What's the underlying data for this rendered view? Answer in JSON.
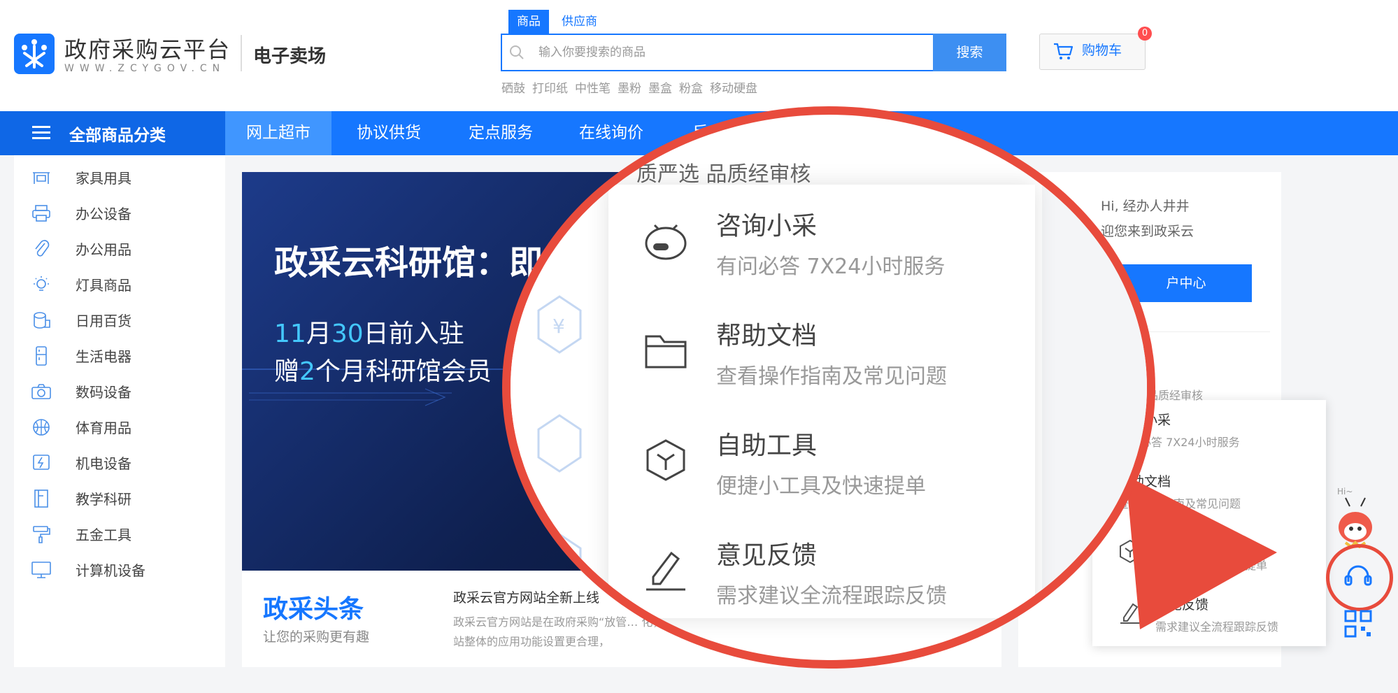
{
  "header": {
    "logo_name": "政府采购云平台",
    "logo_sub": "WWW.ZCYGOV.CN",
    "market_label": "电子卖场",
    "search_tabs": [
      "商品",
      "供应商"
    ],
    "search_placeholder": "输入你要搜索的商品",
    "search_button": "搜索",
    "hot_words": [
      "硒鼓",
      "打印纸",
      "中性笔",
      "墨粉",
      "墨盒",
      "粉盒",
      "移动硬盘"
    ],
    "cart_label": "购物车",
    "cart_count": "0"
  },
  "nav": {
    "all_categories": "全部商品分类",
    "items": [
      "网上超市",
      "协议供货",
      "定点服务",
      "在线询价",
      "反"
    ]
  },
  "categories": [
    "家具用具",
    "办公设备",
    "办公用品",
    "灯具商品",
    "日用百货",
    "生活电器",
    "数码设备",
    "体育用品",
    "机电设备",
    "教学科研",
    "五金工具",
    "计算机设备"
  ],
  "banner": {
    "title": "政采云科研馆：即",
    "line1_parts": [
      "11",
      "月",
      "30",
      "日前入驻"
    ],
    "line2_parts": [
      "赠",
      "2",
      "个月科研馆会员"
    ]
  },
  "news": {
    "logo": "政采头条",
    "tagline": "让您的采购更有趣",
    "title": "政采云官方网站全新上线",
    "text": "政采云官方网站是在政府采购“放管… 化，官方网站整体的应用功能设置更合理，"
  },
  "user_panel": {
    "greet": "Hi, 经办人井井",
    "welcome": "迎您来到政采云",
    "center_button": "户中心"
  },
  "service_menu": {
    "header": "品质经审核",
    "items": [
      {
        "title": "咨询小采",
        "desc": "有问必答 7X24小时服务",
        "icon": "robot-icon"
      },
      {
        "title": "帮助文档",
        "desc": "查看操作指南及常见问题",
        "icon": "folder-icon"
      },
      {
        "title": "自助工具",
        "desc": "便捷小工具及快速提单",
        "icon": "cube-icon"
      },
      {
        "title": "意见反馈",
        "desc": "需求建议全流程跟踪反馈",
        "icon": "pen-icon"
      }
    ]
  },
  "zoom": {
    "header": "质严选 品质经审核"
  },
  "mascot": {
    "hi": "Hi~"
  },
  "colors": {
    "primary": "#1677ff",
    "callout": "#e84b3c"
  }
}
